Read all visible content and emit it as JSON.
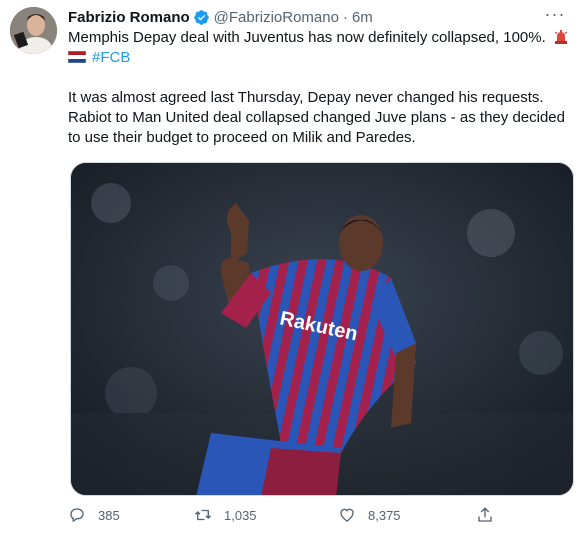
{
  "tweet": {
    "author_name": "Fabrizio Romano",
    "handle": "@FabrizioRomano",
    "separator": "·",
    "time": "6m",
    "line1": "Memphis Depay deal with Juventus has now definitely collapsed, 100%.",
    "hashtag": "#FCB",
    "paragraph2": "It was almost agreed last Thursday, Depay never changed his requests. Rabiot to Man United deal collapsed changed Juve plans - as they decided to use their budget to proceed on Milik and Paredes.",
    "media_logo_text": "Rakuten"
  },
  "actions": {
    "reply_count": "385",
    "retweet_count": "1,035",
    "like_count": "8,375"
  },
  "icons": {
    "verified": "verified-badge-icon",
    "more": "more-dots-icon",
    "siren": "police-light-icon",
    "flag": "netherlands-flag-icon",
    "reply": "reply-icon",
    "retweet": "retweet-icon",
    "like": "like-heart-icon",
    "share": "share-icon"
  },
  "colors": {
    "link": "#1d9bf0",
    "verified": "#1d9bf0",
    "secondary_text": "#536471"
  }
}
